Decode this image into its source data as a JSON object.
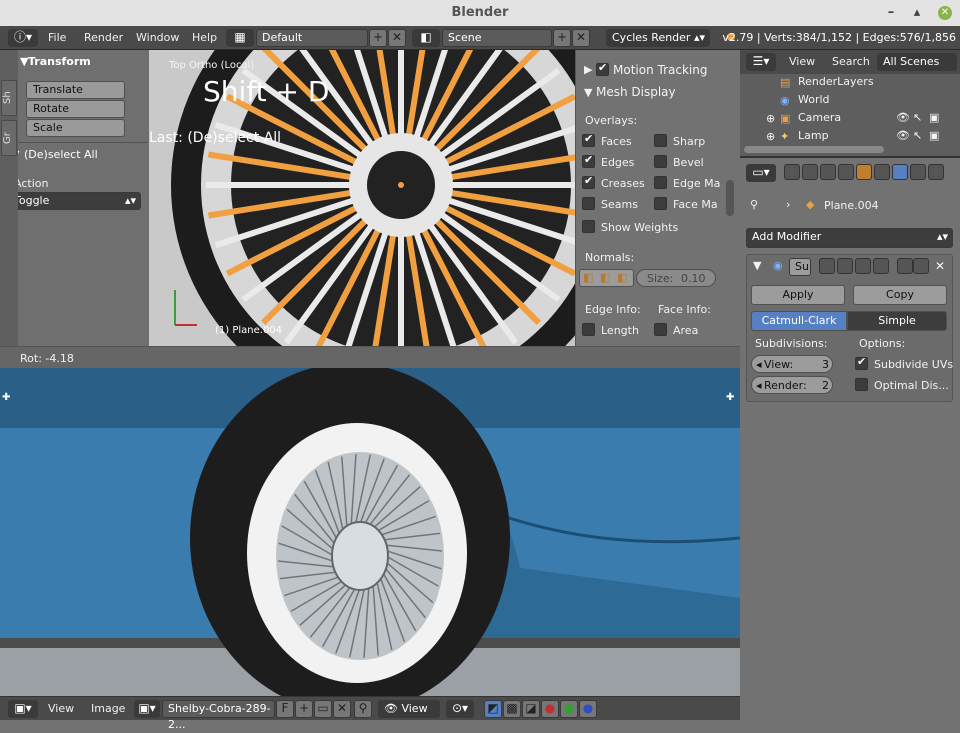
{
  "window": {
    "title": "Blender"
  },
  "infobar": {
    "menus": [
      "File",
      "Render",
      "Window",
      "Help"
    ],
    "layout": "Default",
    "scene": "Scene",
    "engine": "Cycles Render",
    "stats": "v2.79 | Verts:384/1,152 | Edges:576/1,856"
  },
  "toolshelf": {
    "tabs": [
      "Sh",
      "Gr"
    ],
    "transform_title": "Transform",
    "buttons": [
      "Translate",
      "Rotate",
      "Scale"
    ],
    "operator_title": "(De)select All",
    "action_label": "Action",
    "action_value": "Toggle"
  },
  "viewport": {
    "view_label": "Top Ortho (Local)",
    "shortcut": "Shift + D",
    "last_op": "Last: (De)select All",
    "object_label": "(1) Plane.004"
  },
  "props_panel": {
    "motion_tracking": "Motion Tracking",
    "mesh_display": "Mesh Display",
    "overlays": "Overlays:",
    "left_items": [
      {
        "label": "Faces",
        "on": true
      },
      {
        "label": "Edges",
        "on": true
      },
      {
        "label": "Creases",
        "on": true
      },
      {
        "label": "Seams",
        "on": false
      }
    ],
    "right_items": [
      {
        "label": "Sharp",
        "on": false
      },
      {
        "label": "Bevel",
        "on": false
      },
      {
        "label": "Edge Ma",
        "on": false
      },
      {
        "label": "Face Ma",
        "on": false
      }
    ],
    "show_weights": "Show Weights",
    "normals": "Normals:",
    "size": "Size:",
    "size_value": "0.10",
    "edge_info": "Edge Info:",
    "face_info": "Face Info:",
    "length": "Length",
    "area": "Area"
  },
  "status": {
    "rot": "Rot: -4.18"
  },
  "image_editor": {
    "menus": [
      "View",
      "Image"
    ],
    "image_name": "Shelby-Cobra-289-2...",
    "f_label": "F",
    "view_menu": "View"
  },
  "outliner": {
    "view": "View",
    "search": "Search",
    "filter": "All Scenes",
    "items": [
      "RenderLayers",
      "World",
      "Camera",
      "Lamp"
    ]
  },
  "properties": {
    "object_name": "Plane.004",
    "add_modifier": "Add Modifier",
    "mod_name": "Su",
    "apply": "Apply",
    "copy": "Copy",
    "tab_catmull": "Catmull-Clark",
    "tab_simple": "Simple",
    "subdivisions": "Subdivisions:",
    "options": "Options:",
    "view_label": "View:",
    "view_value": "3",
    "render_label": "Render:",
    "render_value": "2",
    "subdivide_uvs": "Subdivide UVs",
    "optimal_display": "Optimal Dis..."
  },
  "colors": {
    "accent": "#5680c2",
    "selected_edge": "#f0a040",
    "car_blue": "#2f6e9e"
  }
}
